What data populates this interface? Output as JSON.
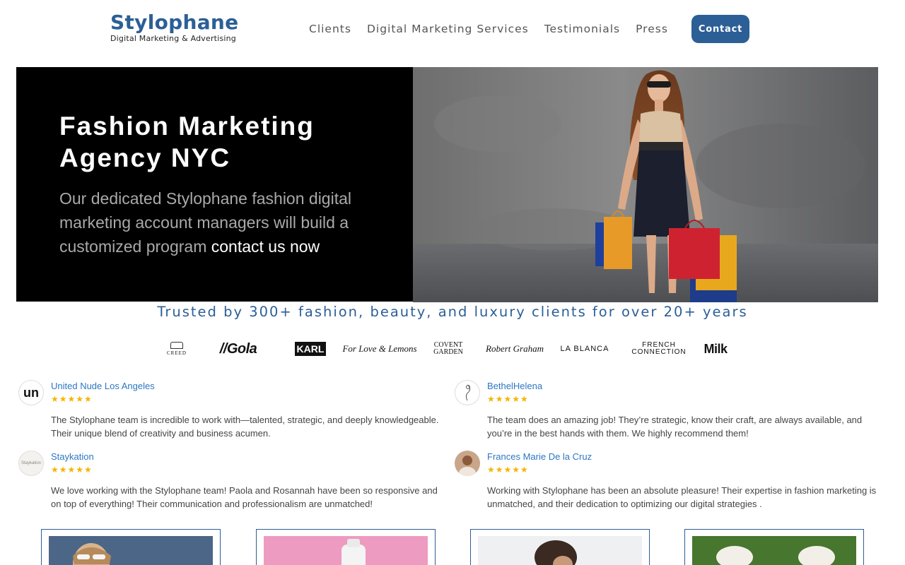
{
  "header": {
    "logo_name": "Stylophane",
    "logo_tagline": "Digital Marketing & Advertising",
    "nav": [
      {
        "label": "Clients"
      },
      {
        "label": "Digital Marketing Services"
      },
      {
        "label": "Testimonials"
      },
      {
        "label": "Press"
      }
    ],
    "contact_label": "Contact",
    "accent_color": "#2c5f96"
  },
  "hero": {
    "title": "Fashion Marketing Agency NYC",
    "subtitle": "Our dedicated Stylophane fashion digital marketing account managers will build a customized program",
    "cta_link": "contact us now"
  },
  "trusted": {
    "heading": "Trusted by 300+ fashion, beauty, and luxury clients for over 20+ years",
    "brands": [
      "CREED",
      "Gola",
      "KARL",
      "For Love & Lemons",
      "COVENT GARDEN",
      "Robert Graham",
      "LA BLANCA",
      "FRENCH CONNECTION",
      "Milk"
    ]
  },
  "reviews": [
    {
      "name": "United Nude Los Angeles",
      "avatar_text": "un",
      "stars": "★★★★★",
      "text": "The Stylophane team is incredible to work with—talented, strategic, and deeply knowledgeable. Their unique blend of creativity and business acumen."
    },
    {
      "name": "BethelHelena",
      "avatar_text": "",
      "stars": "★★★★★",
      "text": "The team does an amazing job! They’re strategic, know their craft, are always available, and you’re in the best hands with them. We highly recommend them!"
    },
    {
      "name": "Staykation",
      "avatar_text": "Staykation",
      "stars": "★★★★★",
      "text": "We love working with the Stylophane team! Paola and Rosannah have been so responsive and on top of everything! Their communication and professionalism are unmatched!"
    },
    {
      "name": "Frances Marie De la Cruz",
      "avatar_text": "",
      "stars": "★★★★★",
      "text": "Working with Stylophane has been an absolute pleasure! Their expertise in fashion marketing is unmatched, and their dedication to optimizing our digital strategies ."
    }
  ]
}
